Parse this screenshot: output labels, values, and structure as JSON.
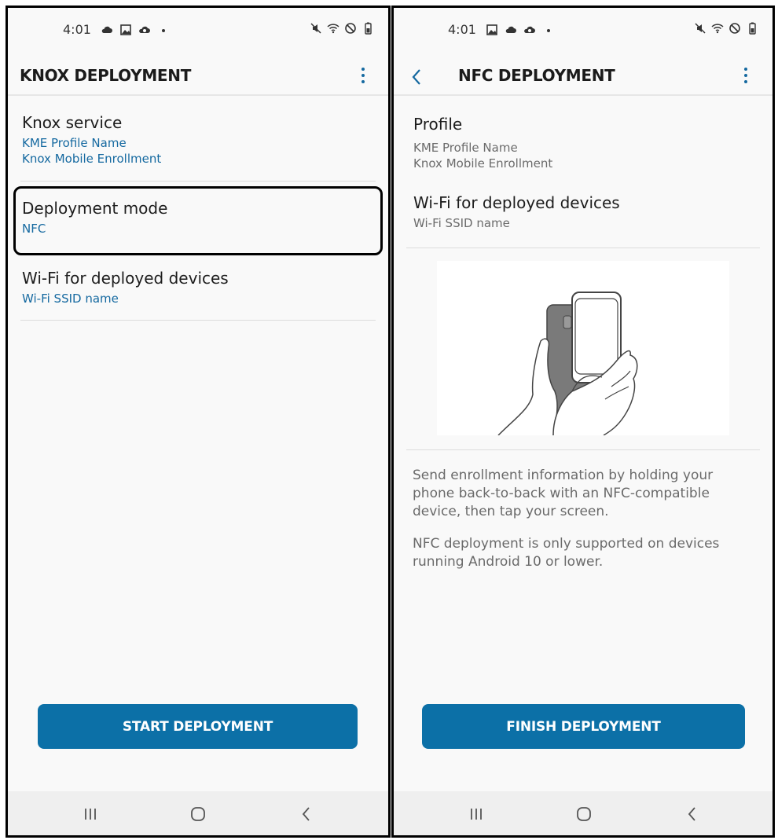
{
  "left_screen": {
    "status_bar": {
      "time": "4:01"
    },
    "app_bar": {
      "title": "KNOX DEPLOYMENT"
    },
    "items": [
      {
        "title": "Knox service",
        "subtitles": [
          "KME Profile Name",
          "Knox Mobile Enrollment"
        ]
      },
      {
        "title": "Deployment mode",
        "subtitles": [
          "NFC"
        ]
      },
      {
        "title": "Wi-Fi for deployed devices",
        "subtitles": [
          "Wi-Fi SSID name"
        ]
      }
    ],
    "button_label": "START DEPLOYMENT"
  },
  "right_screen": {
    "status_bar": {
      "time": "4:01"
    },
    "app_bar": {
      "title": "NFC DEPLOYMENT"
    },
    "items": [
      {
        "title": "Profile",
        "subtitles": [
          "KME Profile Name",
          "Knox Mobile Enrollment"
        ]
      },
      {
        "title": "Wi-Fi for deployed devices",
        "subtitles": [
          "Wi-Fi SSID name"
        ]
      }
    ],
    "description": [
      "Send enrollment information by holding your phone back-to-back with an NFC-compatible device, then tap your screen.",
      "NFC deployment is only supported on devices running Android 10 or lower."
    ],
    "button_label": "FINISH DEPLOYMENT"
  },
  "colors": {
    "accent": "#0c70a7",
    "link": "#1569a0",
    "background": "#f9f9f9"
  },
  "icons": {
    "status_left": [
      "cloud-icon",
      "image-icon",
      "cloud-sync-icon",
      "dot-icon"
    ],
    "status_right": [
      "mute-icon",
      "wifi-icon",
      "do-not-disturb-icon",
      "battery-icon"
    ],
    "nav": [
      "recent-apps-icon",
      "home-icon",
      "back-icon"
    ]
  }
}
